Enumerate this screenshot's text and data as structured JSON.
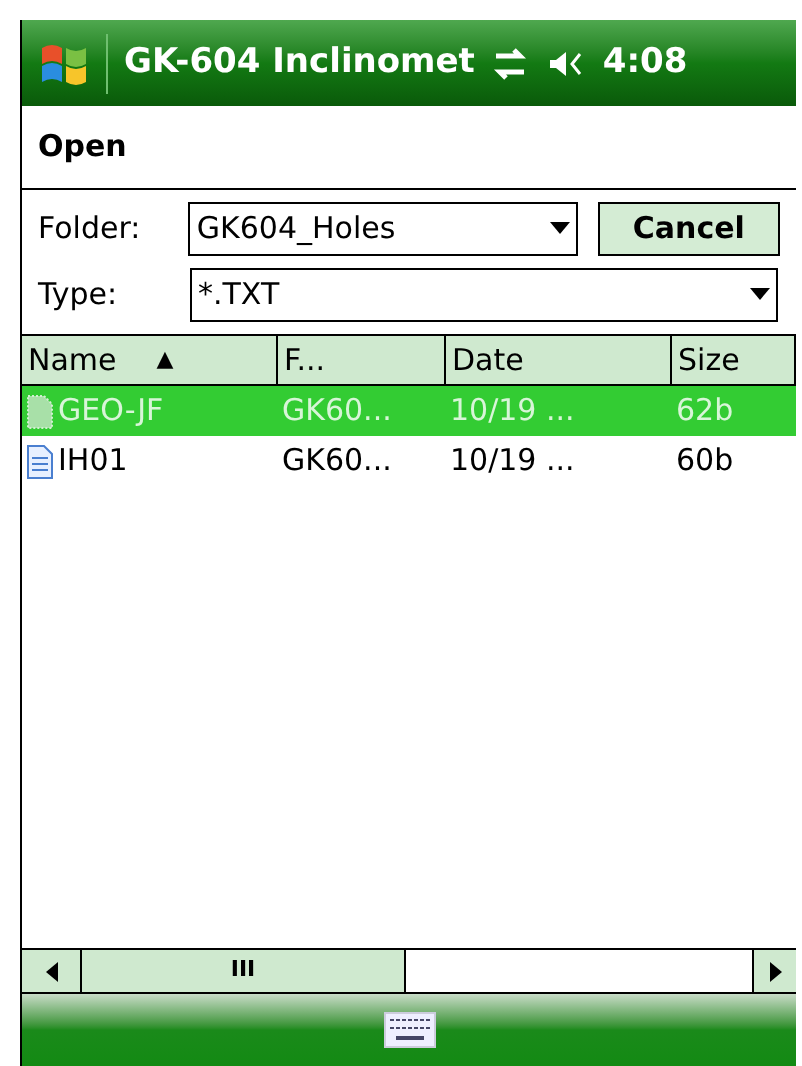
{
  "status_bar": {
    "title": "GK-604 Inclinomet",
    "time": "4:08"
  },
  "dialog": {
    "title": "Open"
  },
  "folder": {
    "label": "Folder:",
    "value": "GK604_Holes"
  },
  "cancel_button": "Cancel",
  "type": {
    "label": "Type:",
    "value": "*.TXT"
  },
  "table": {
    "columns": [
      {
        "label": "Name",
        "sort_icon": "▲"
      },
      {
        "label": "F..."
      },
      {
        "label": "Date"
      },
      {
        "label": "Size"
      }
    ],
    "rows": [
      {
        "cells": [
          "GEO-JF",
          "GK60...",
          "10/19 ...",
          "62b"
        ],
        "selected": true
      },
      {
        "cells": [
          "IH01",
          "GK60...",
          "10/19 ...",
          "60b"
        ],
        "selected": false
      }
    ]
  },
  "scrollbar": {
    "grip": "III"
  }
}
